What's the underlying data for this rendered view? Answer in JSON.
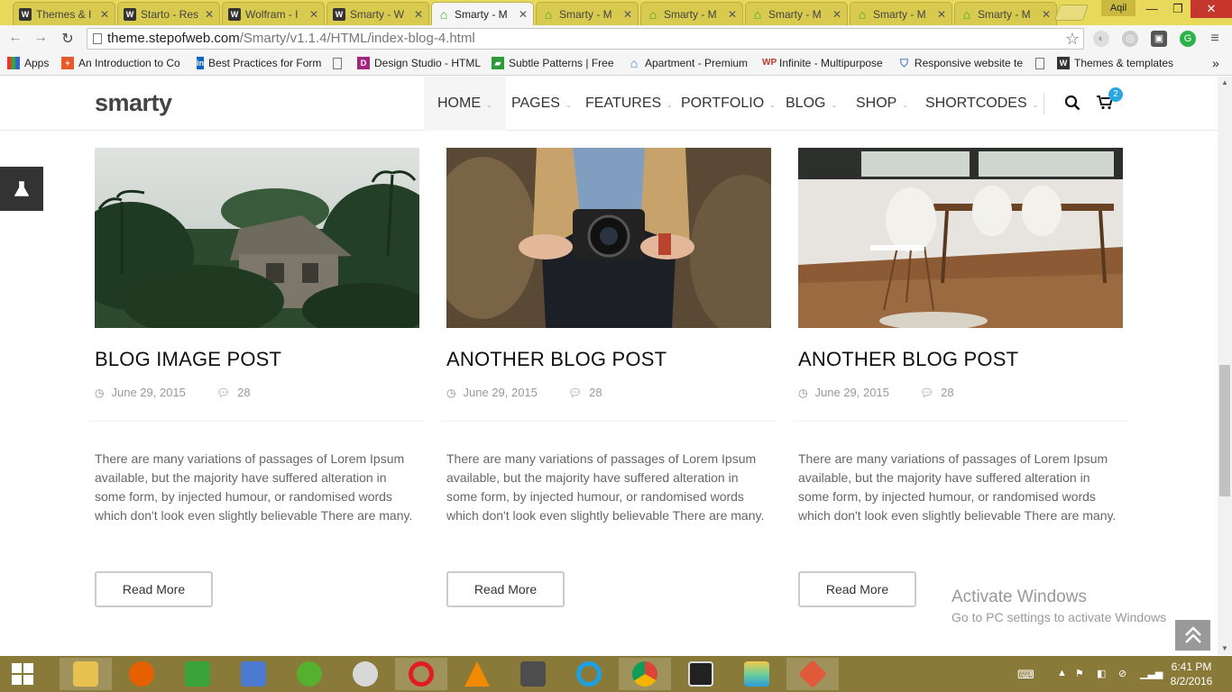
{
  "browser": {
    "tabs": [
      {
        "title": "Themes & I",
        "icon": "w-icon"
      },
      {
        "title": "Starto - Res",
        "icon": "w-icon"
      },
      {
        "title": "Wolfram - I",
        "icon": "w-icon"
      },
      {
        "title": "Smarty - W",
        "icon": "w-icon"
      },
      {
        "title": "Smarty - M",
        "icon": "home-icon",
        "active": true
      },
      {
        "title": "Smarty - M",
        "icon": "home-icon"
      },
      {
        "title": "Smarty - M",
        "icon": "home-icon"
      },
      {
        "title": "Smarty - M",
        "icon": "home-icon"
      },
      {
        "title": "Smarty - M",
        "icon": "home-icon"
      },
      {
        "title": "Smarty - M",
        "icon": "home-icon"
      }
    ],
    "user": "Aqil",
    "url_host": "theme.stepofweb.com",
    "url_path": "/Smarty/v1.1.4/HTML/index-blog-4.html",
    "bookmarks": [
      {
        "label": "Apps"
      },
      {
        "label": "An Introduction to Co"
      },
      {
        "label": "Best Practices for Form"
      },
      {
        "label": "Design Studio - HTML"
      },
      {
        "label": "Subtle Patterns | Free"
      },
      {
        "label": "Apartment - Premium"
      },
      {
        "label": "Infinite - Multipurpose"
      },
      {
        "label": "Responsive website te"
      },
      {
        "label": "Themes & templates"
      }
    ],
    "more": "»"
  },
  "site": {
    "logo": "smarty",
    "menu": [
      "HOME",
      "PAGES",
      "FEATURES",
      "PORTFOLIO",
      "BLOG",
      "SHOP",
      "SHORTCODES"
    ],
    "cart_count": "2"
  },
  "posts": [
    {
      "title": "BLOG IMAGE POST",
      "date": "June 29, 2015",
      "comments": "28",
      "excerpt": "There are many variations of passages of Lorem Ipsum available, but the majority have suffered alteration in some form, by injected humour, or randomised words which don't look even slightly believable There are many.",
      "button": "Read More"
    },
    {
      "title": "ANOTHER BLOG POST",
      "date": "June 29, 2015",
      "comments": "28",
      "excerpt": "There are many variations of passages of Lorem Ipsum available, but the majority have suffered alteration in some form, by injected humour, or randomised words which don't look even slightly believable There are many.",
      "button": "Read More"
    },
    {
      "title": "ANOTHER BLOG POST",
      "date": "June 29, 2015",
      "comments": "28",
      "excerpt": "There are many variations of passages of Lorem Ipsum available, but the majority have suffered alteration in some form, by injected humour, or randomised words which don't look even slightly believable There are many.",
      "button": "Read More"
    }
  ],
  "watermark": {
    "line1": "Activate Windows",
    "line2": "Go to PC settings to activate Windows"
  },
  "taskbar": {
    "time": "6:41 PM",
    "date": "8/2/2016"
  },
  "colors": {
    "tabbar": "#e9d95a",
    "accent_badge": "#2aa6e0",
    "taskbar": "#8a7a3a"
  }
}
